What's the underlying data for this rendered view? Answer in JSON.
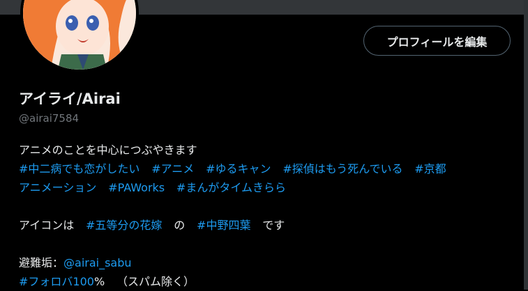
{
  "profile": {
    "display_name": "アイライ/Airai",
    "handle": "@airai7584",
    "edit_button_label": "プロフィールを編集"
  },
  "bio": {
    "line1": "アニメのことを中心につぶやきます",
    "hashtags_row": [
      "#中二病でも恋がしたい",
      "#アニメ",
      "#ゆるキャン",
      "#探偵はもう死んでいる",
      "#京都"
    ],
    "hashtags_row2": [
      "アニメーション",
      "#PAWorks",
      "#まんがタイムきらら"
    ],
    "icon_line": {
      "prefix": "アイコンは",
      "tag1": "#五等分の花嫁",
      "middle": "の",
      "tag2": "#中野四葉",
      "suffix": "です"
    },
    "evacuation": {
      "label": "避難垢：",
      "mention": "@airai_sabu"
    },
    "follow_back": {
      "tag": "#フォロバ100",
      "percent": "%",
      "note": "（スパム除く）"
    }
  },
  "colors": {
    "background": "#000000",
    "text": "#e7e9ea",
    "secondary_text": "#71767b",
    "link": "#1d9bf0",
    "banner": "#333639"
  }
}
